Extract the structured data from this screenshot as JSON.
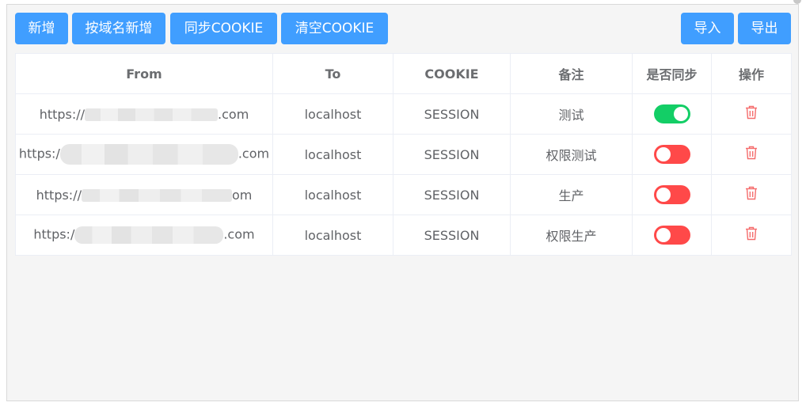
{
  "toolbar": {
    "add": "新增",
    "add_by_domain": "按域名新增",
    "sync_cookie": "同步COOKIE",
    "clear_cookie": "清空COOKIE",
    "import": "导入",
    "export": "导出",
    "button_color": "#409eff"
  },
  "table": {
    "headers": [
      "From",
      "To",
      "COOKIE",
      "备注",
      "是否同步",
      "操作"
    ],
    "rows": [
      {
        "from_prefix": "https://",
        "from_suffix": ".com",
        "to": "localhost",
        "cookie": "SESSION",
        "note": "测试",
        "sync": true
      },
      {
        "from_prefix": "https:/",
        "from_suffix": ".com",
        "to": "localhost",
        "cookie": "SESSION",
        "note": "权限测试",
        "sync": false
      },
      {
        "from_prefix": "https://",
        "from_suffix": "om",
        "to": "localhost",
        "cookie": "SESSION",
        "note": "生产",
        "sync": false
      },
      {
        "from_prefix": "https:/",
        "from_suffix": ".com",
        "to": "localhost",
        "cookie": "SESSION",
        "note": "权限生产",
        "sync": false
      }
    ],
    "row_action_icon": "trash-icon",
    "switch_on_color": "#13ce66",
    "switch_off_color": "#ff4949",
    "delete_icon_color": "#f56c6c"
  }
}
